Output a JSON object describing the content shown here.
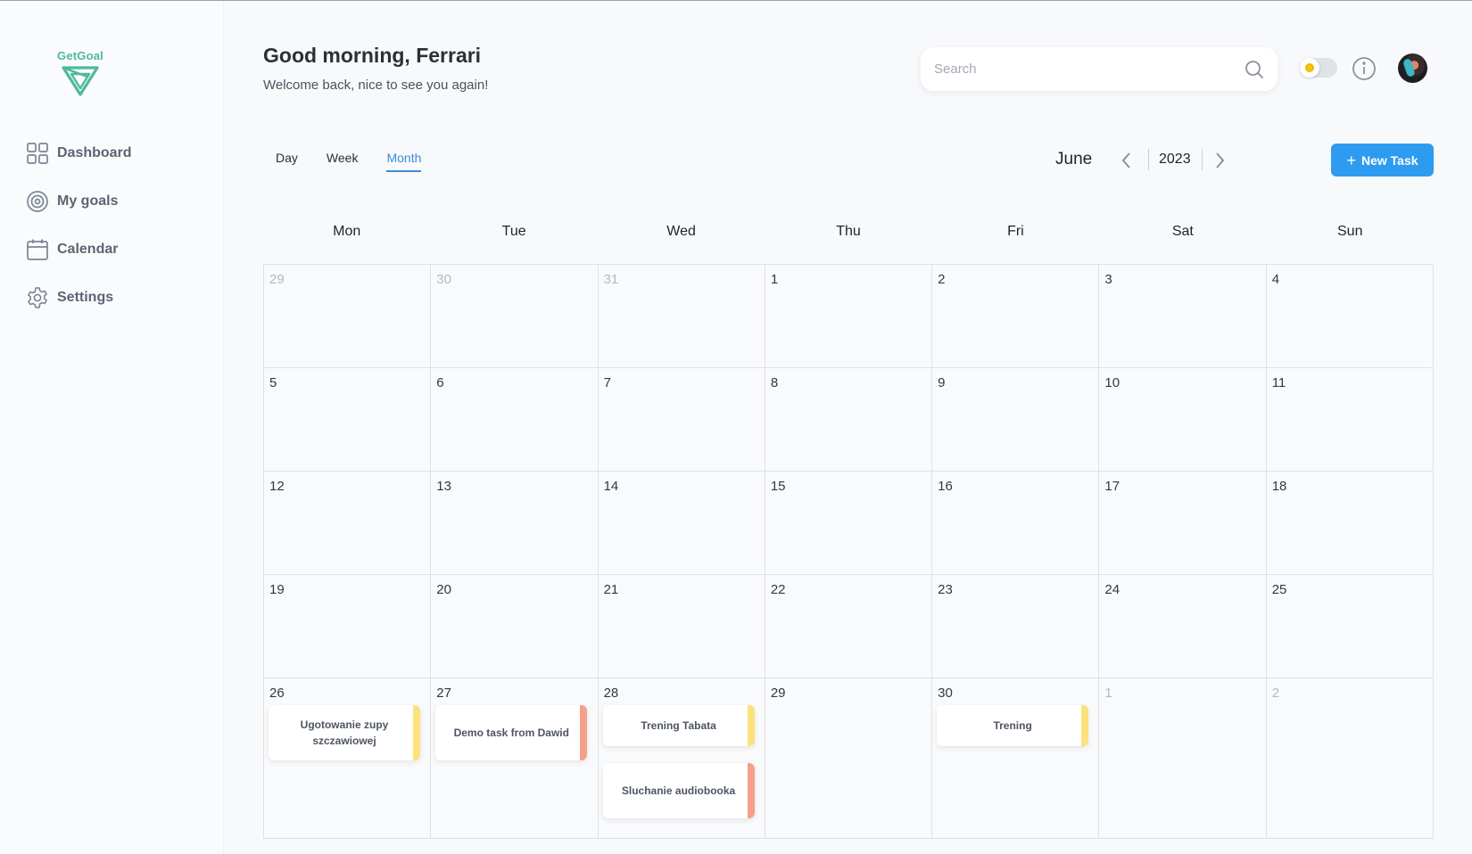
{
  "app": {
    "brand": "GetGoal"
  },
  "sidebar": {
    "items": [
      {
        "label": "Dashboard",
        "icon": "grid-icon"
      },
      {
        "label": "My goals",
        "icon": "target-icon"
      },
      {
        "label": "Calendar",
        "icon": "calendar-icon"
      },
      {
        "label": "Settings",
        "icon": "gear-icon"
      }
    ]
  },
  "header": {
    "greeting": "Good morning, Ferrari",
    "subtitle": "Welcome back, nice to see you again!",
    "search_placeholder": "Search"
  },
  "calendar": {
    "views": [
      "Day",
      "Week",
      "Month"
    ],
    "active_view": "Month",
    "month": "June",
    "year": "2023",
    "new_task_label": "New Task",
    "weekdays": [
      "Mon",
      "Tue",
      "Wed",
      "Thu",
      "Fri",
      "Sat",
      "Sun"
    ],
    "days": [
      {
        "n": "29",
        "muted": true
      },
      {
        "n": "30",
        "muted": true
      },
      {
        "n": "31",
        "muted": true
      },
      {
        "n": "1"
      },
      {
        "n": "2"
      },
      {
        "n": "3"
      },
      {
        "n": "4"
      },
      {
        "n": "5"
      },
      {
        "n": "6"
      },
      {
        "n": "7"
      },
      {
        "n": "8"
      },
      {
        "n": "9"
      },
      {
        "n": "10"
      },
      {
        "n": "11"
      },
      {
        "n": "12"
      },
      {
        "n": "13"
      },
      {
        "n": "14"
      },
      {
        "n": "15"
      },
      {
        "n": "16"
      },
      {
        "n": "17"
      },
      {
        "n": "18"
      },
      {
        "n": "19"
      },
      {
        "n": "20"
      },
      {
        "n": "21"
      },
      {
        "n": "22"
      },
      {
        "n": "23"
      },
      {
        "n": "24"
      },
      {
        "n": "25"
      },
      {
        "n": "26",
        "tasks": [
          {
            "title": "Ugotowanie zupy szczawiowej",
            "color": "#fbe27a"
          }
        ]
      },
      {
        "n": "27",
        "tasks": [
          {
            "title": "Demo task from Dawid",
            "color": "#f4a08a"
          }
        ]
      },
      {
        "n": "28",
        "tasks": [
          {
            "title": "Trening Tabata",
            "color": "#fbe27a"
          },
          {
            "title": "Sluchanie audiobooka",
            "color": "#f4a08a"
          }
        ]
      },
      {
        "n": "29"
      },
      {
        "n": "30",
        "tasks": [
          {
            "title": "Trening",
            "color": "#fbe27a"
          }
        ]
      },
      {
        "n": "1",
        "muted": true
      },
      {
        "n": "2",
        "muted": true
      }
    ]
  },
  "colors": {
    "accent": "#2d9cf0",
    "active_tab": "#3d8bd9",
    "brand": "#4fb99a"
  }
}
